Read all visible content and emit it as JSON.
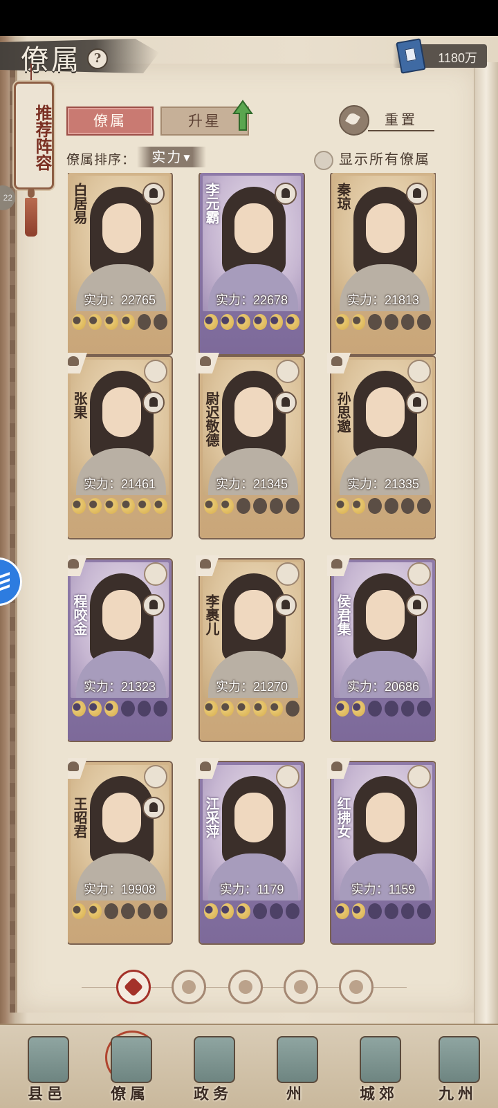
{
  "header": {
    "title": "僚属",
    "help_icon": "help-icon",
    "currency_amount": "1180万",
    "currency_icon": "book-icon"
  },
  "side_tag": {
    "label": "推荐阵容",
    "bubble_text": "22"
  },
  "tabs": [
    {
      "label": "僚属",
      "active": true
    },
    {
      "label": "升星",
      "active": false
    }
  ],
  "reset_label": "重置",
  "sort": {
    "label": "僚属排序：",
    "value": "实力"
  },
  "show_all_label": "显示所有僚属",
  "power_prefix": "实力：",
  "officers": [
    {
      "name": "白居易",
      "power": "22765",
      "stars": 4,
      "rarity": "gold"
    },
    {
      "name": "李元霸",
      "power": "22678",
      "stars": 6,
      "rarity": "purple"
    },
    {
      "name": "秦琼",
      "power": "21813",
      "stars": 2,
      "rarity": "gold"
    },
    {
      "name": "张果",
      "power": "21461",
      "stars": 6,
      "rarity": "gold"
    },
    {
      "name": "尉迟敬德",
      "power": "21345",
      "stars": 2,
      "rarity": "gold"
    },
    {
      "name": "孙思邈",
      "power": "21335",
      "stars": 2,
      "rarity": "gold"
    },
    {
      "name": "程咬金",
      "power": "21323",
      "stars": 3,
      "rarity": "purple"
    },
    {
      "name": "李裹儿",
      "power": "21270",
      "stars": 5,
      "rarity": "gold"
    },
    {
      "name": "侯君集",
      "power": "20686",
      "stars": 2,
      "rarity": "purple"
    },
    {
      "name": "王昭君",
      "power": "19908",
      "stars": 2,
      "rarity": "gold"
    },
    {
      "name": "江采萍",
      "power": "1179",
      "stars": 3,
      "rarity": "purple"
    },
    {
      "name": "红拂女",
      "power": "1159",
      "stars": 2,
      "rarity": "purple"
    }
  ],
  "filters": [
    "all-filter-icon",
    "filter-icon-2",
    "filter-icon-3",
    "filter-icon-4",
    "filter-icon-5"
  ],
  "nav": [
    {
      "label": "县邑",
      "active": false
    },
    {
      "label": "僚属",
      "active": true
    },
    {
      "label": "政务",
      "active": false
    },
    {
      "label": "州",
      "active": false
    },
    {
      "label": "城郊",
      "active": false
    },
    {
      "label": "九州",
      "active": false
    }
  ],
  "colors": {
    "tab_active": "#c97a72",
    "card_gold": "#c9a679",
    "card_purple": "#7d6a9a",
    "accent_red": "#a4322a"
  }
}
